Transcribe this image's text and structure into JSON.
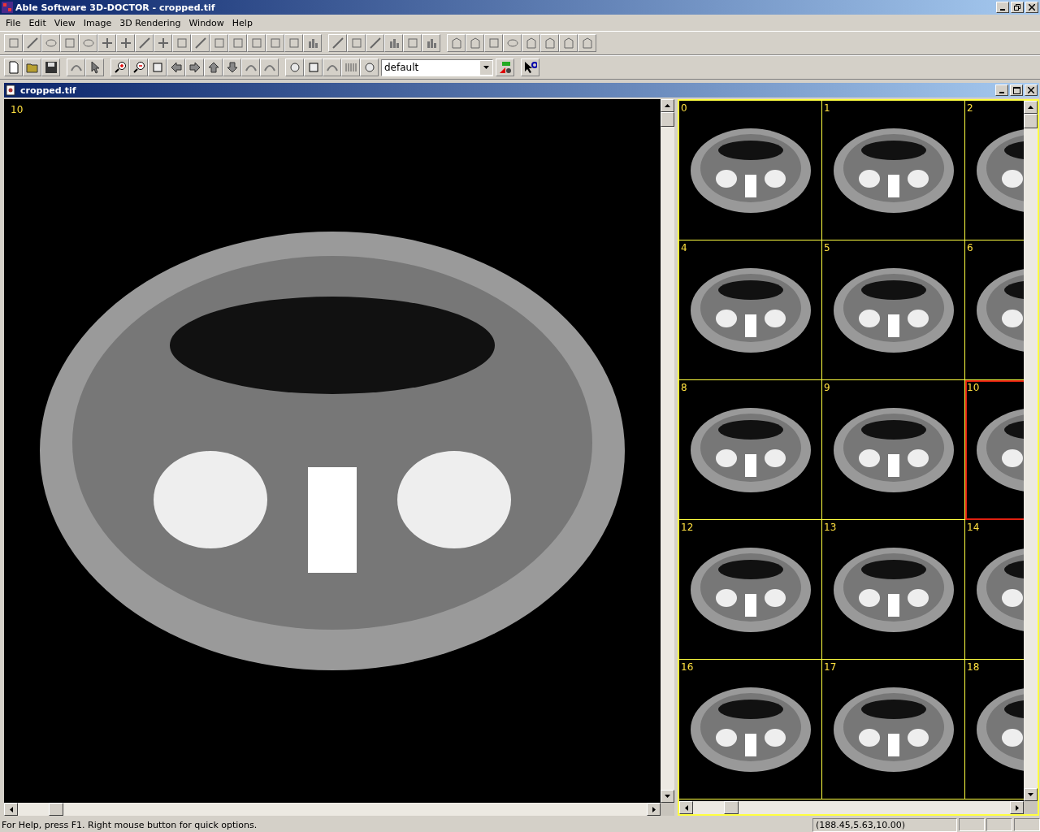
{
  "window": {
    "title": "Able Software 3D-DOCTOR - cropped.tif"
  },
  "menu": [
    "File",
    "Edit",
    "View",
    "Image",
    "3D Rendering",
    "Window",
    "Help"
  ],
  "toolbar": {
    "preset": "default"
  },
  "document": {
    "title": "cropped.tif",
    "slice_label": "10",
    "thumbnails": [
      {
        "label": "0",
        "selected": false
      },
      {
        "label": "1",
        "selected": false
      },
      {
        "label": "2",
        "selected": false
      },
      {
        "label": "4",
        "selected": false
      },
      {
        "label": "5",
        "selected": false
      },
      {
        "label": "6",
        "selected": false
      },
      {
        "label": "8",
        "selected": false
      },
      {
        "label": "9",
        "selected": false
      },
      {
        "label": "10",
        "selected": true
      },
      {
        "label": "12",
        "selected": false
      },
      {
        "label": "13",
        "selected": false
      },
      {
        "label": "14",
        "selected": false
      },
      {
        "label": "16",
        "selected": false
      },
      {
        "label": "17",
        "selected": false
      },
      {
        "label": "18",
        "selected": false
      }
    ]
  },
  "status_bar": {
    "message": "For Help, press F1. Right mouse button for quick options.",
    "coordinates": "(188.45,5.63,10.00)"
  }
}
